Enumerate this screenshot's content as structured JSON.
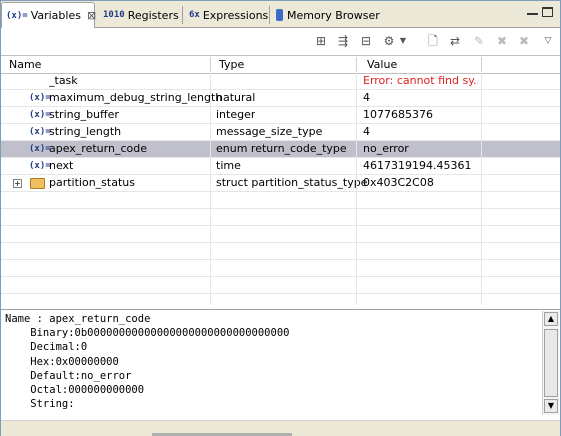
{
  "tabs": [
    {
      "label": "Variables",
      "icon": "(x)=",
      "active": true
    },
    {
      "label": "Registers",
      "icon": "1010"
    },
    {
      "label": "Expressions",
      "icon": "6x"
    },
    {
      "label": "Memory Browser",
      "icon": "memory"
    }
  ],
  "columns": {
    "name": "Name",
    "type": "Type",
    "value": "Value"
  },
  "rows": [
    {
      "name": "_task",
      "type": "",
      "value": "Error: cannot find sy..."
    },
    {
      "name": "maximum_debug_string_length",
      "type": "natural",
      "value": "4"
    },
    {
      "name": "string_buffer",
      "type": "integer",
      "value": "1077685376"
    },
    {
      "name": "string_length",
      "type": "message_size_type",
      "value": "4"
    },
    {
      "name": "apex_return_code",
      "type": "enum return_code_type",
      "value": "no_error"
    },
    {
      "name": "next",
      "type": "time",
      "value": "4617319194.45361"
    },
    {
      "name": "partition_status",
      "type": "struct partition_status_type",
      "value": "0x403C2C08"
    }
  ],
  "detail": {
    "line1": "Name : apex_return_code",
    "line2": "    Binary:0b00000000000000000000000000000000",
    "line3": "    Decimal:0",
    "line4": "    Hex:0x00000000",
    "line5": "    Default:no_error",
    "line6": "    Octal:000000000000",
    "line7": "    String:"
  },
  "icons": {
    "variable": "(x)=",
    "error_color": "#e02020",
    "selected_row_color": "#c0c0cc"
  }
}
